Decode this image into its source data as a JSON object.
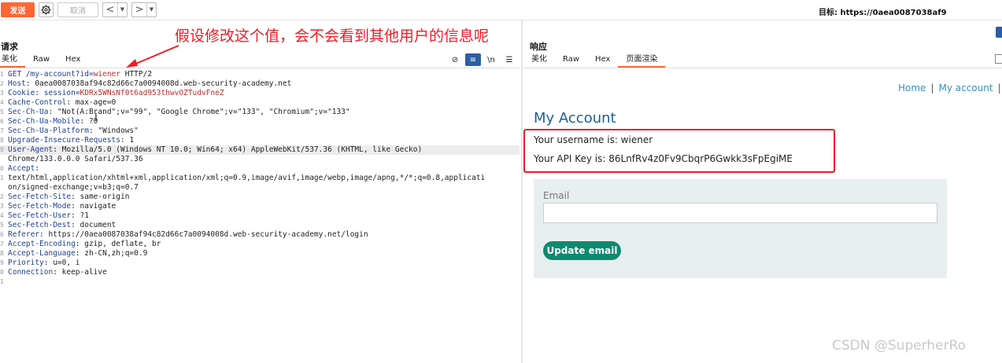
{
  "toolbar": {
    "send_label": "发送",
    "settings_icon": "gear-icon",
    "cancel_label": "取消",
    "back_glyph": "<",
    "forward_glyph": ">",
    "dropdown_glyph": "▼",
    "target_text": "目标: https://0aea0087038af9"
  },
  "annotation": {
    "text": "假设修改这个值，会不会看到其他用户的信息呢",
    "color": "#ee1c24"
  },
  "request": {
    "title": "请求",
    "tabs": [
      "美化",
      "Raw",
      "Hex"
    ],
    "active_tab": "美化",
    "tool_icons": {
      "hide": "⊘",
      "wrap": "≡",
      "newline": "\\n",
      "menu": "☰"
    },
    "line_numbers": [
      "1",
      "2",
      "3",
      "4",
      "5",
      "6",
      "7",
      "8",
      "9",
      "",
      "0",
      "1",
      "",
      "2",
      "3",
      "4",
      "5",
      "6",
      "7",
      "8",
      "9",
      "0",
      "1"
    ],
    "lines": [
      {
        "n": "GET /my-account?",
        "v": "",
        "p1": "id=",
        "r": "wiener",
        "tail": " HTTP/2"
      },
      {
        "n": "Host",
        "v": ": 0aea0087038af94c82d66c7a0094008d.web-security-academy.net"
      },
      {
        "n": "Cookie",
        "v": ": ",
        "p1": "session=",
        "r": "KDRx5WNsNf0t6ad953thwvOZTudvFneZ"
      },
      {
        "n": "Cache-Control",
        "v": ": max-age=0"
      },
      {
        "n": "Sec-Ch-Ua",
        "v": ": \"Not(A:Brand\";v=\"99\", \"Google Chrome\";v=\"133\", \"Chromium\";v=\"133\""
      },
      {
        "n": "Sec-Ch-Ua-Mobile",
        "v": ": ?0"
      },
      {
        "n": "Sec-Ch-Ua-Platform",
        "v": ": \"Windows\""
      },
      {
        "n": "Upgrade-Insecure-Requests",
        "v": ": 1"
      },
      {
        "n": "User-Agent",
        "v": ": Mozilla/5.0 (Windows NT 10.0; Win64; x64) AppleWebKit/537.36 (KHTML, like Gecko)"
      },
      {
        "n": "",
        "v": "Chrome/133.0.0.0 Safari/537.36"
      },
      {
        "n": "Accept",
        "v": ":"
      },
      {
        "n": "",
        "v": "text/html,application/xhtml+xml,application/xml;q=0.9,image/avif,image/webp,image/apng,*/*;q=0.8,applicati"
      },
      {
        "n": "",
        "v": "on/signed-exchange;v=b3;q=0.7"
      },
      {
        "n": "Sec-Fetch-Site",
        "v": ": same-origin"
      },
      {
        "n": "Sec-Fetch-Mode",
        "v": ": navigate"
      },
      {
        "n": "Sec-Fetch-User",
        "v": ": ?1"
      },
      {
        "n": "Sec-Fetch-Dest",
        "v": ": document"
      },
      {
        "n": "Referer",
        "v": ": https://0aea0087038af94c82d66c7a0094008d.web-security-academy.net/login"
      },
      {
        "n": "Accept-Encoding",
        "v": ": gzip, deflate, br"
      },
      {
        "n": "Accept-Language",
        "v": ": zh-CN,zh;q=0.9"
      },
      {
        "n": "Priority",
        "v": ": u=0, i"
      },
      {
        "n": "Connection",
        "v": ": keep-alive"
      },
      {
        "n": "",
        "v": ""
      },
      {
        "n": "",
        "v": ""
      }
    ]
  },
  "response": {
    "title": "响应",
    "tabs": [
      "美化",
      "Raw",
      "Hex",
      "页面渲染"
    ],
    "active_tab": "页面渲染",
    "page": {
      "nav_home": "Home",
      "nav_sep": "|",
      "nav_account": "My account",
      "nav_sep2": "|",
      "heading": "My Account",
      "username_line": "Your username is: wiener",
      "apikey_line": "Your API Key is: 86LnfRv4z0Fv9CbqrP6Gwkk3sFpEgiME",
      "email_label": "Email",
      "email_value": "",
      "update_button": "Update email"
    }
  },
  "colors": {
    "accent": "#ff6633",
    "link": "#3a8ec2",
    "heading": "#1d5e9c",
    "button": "#0d8a6e",
    "highlight_box": "#ee1c24"
  },
  "watermark": "CSDN @SuperherRo"
}
